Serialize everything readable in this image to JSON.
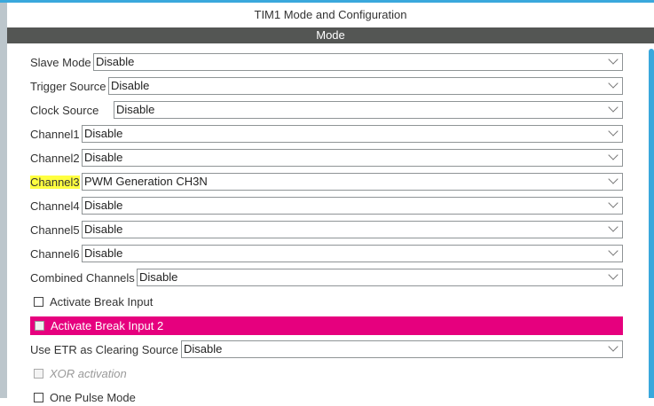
{
  "title": "TIM1 Mode and Configuration",
  "section": "Mode",
  "fields": [
    {
      "label": "Slave Mode",
      "value": "Disable"
    },
    {
      "label": "Trigger Source",
      "value": "Disable"
    },
    {
      "label": "Clock Source",
      "value": "Disable"
    },
    {
      "label": "Channel1",
      "value": "Disable"
    },
    {
      "label": "Channel2",
      "value": "Disable"
    },
    {
      "label": "Channel3",
      "value": "PWM Generation CH3N"
    },
    {
      "label": "Channel4",
      "value": "Disable"
    },
    {
      "label": "Channel5",
      "value": "Disable"
    },
    {
      "label": "Channel6",
      "value": "Disable"
    },
    {
      "label": "Combined Channels",
      "value": "Disable"
    }
  ],
  "break_input": {
    "label": "Activate Break Input",
    "checked": false
  },
  "break_input2": {
    "label": "Activate Break Input 2",
    "checked": false
  },
  "etr": {
    "label": "Use ETR as Clearing Source",
    "value": "Disable"
  },
  "xor": {
    "label": "XOR activation",
    "checked": false,
    "disabled": true
  },
  "one_pulse": {
    "label": "One Pulse Mode",
    "checked": false
  },
  "colors": {
    "accent": "#3aa8dc",
    "highlight": "#e6007e",
    "header": "#545654"
  }
}
